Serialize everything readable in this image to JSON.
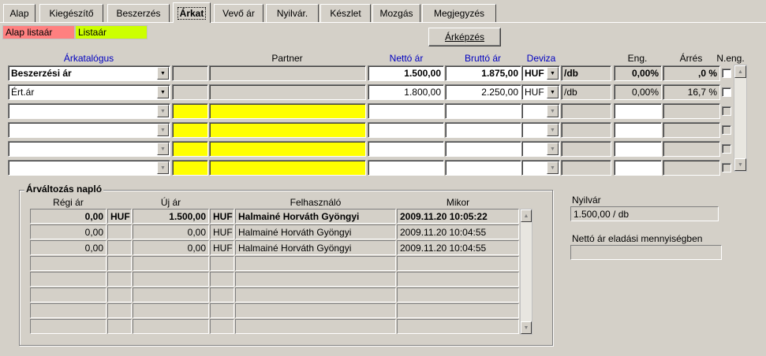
{
  "tabs": [
    "Alap",
    "Kiegészítő",
    "Beszerzés",
    "Árkat",
    "Vevő ár",
    "Nyilvár.",
    "Készlet",
    "Mozgás",
    "Megjegyzés"
  ],
  "legend": {
    "alap_listaar": "Alap listaár",
    "listaar": "Listaár",
    "alap_color": "#ff8080",
    "lista_color": "#ccff00"
  },
  "arkepzes_button": "Árképzés",
  "headers": {
    "arkatalogus": "Árkatalógus",
    "partner": "Partner",
    "netto": "Nettó ár",
    "brutto": "Bruttó ár",
    "deviza": "Deviza",
    "eng": "Eng.",
    "arres": "Árrés",
    "neng": "N.eng."
  },
  "rows": [
    {
      "katalogus": "Beszerzési ár",
      "partner_code": "",
      "partner": "",
      "netto": "1.500,00",
      "brutto": "1.875,00",
      "deviza": "HUF",
      "unit": "/db",
      "eng": "0,00%",
      "arres": ",0 %",
      "bold": true
    },
    {
      "katalogus": "Ért.ár",
      "partner_code": "",
      "partner": "",
      "netto": "1.800,00",
      "brutto": "2.250,00",
      "deviza": "HUF",
      "unit": "/db",
      "eng": "0,00%",
      "arres": "16,7 %",
      "bold": false
    }
  ],
  "log": {
    "title": "Árváltozás napló",
    "headers": {
      "regi": "Régi ár",
      "uj": "Új ár",
      "felhasznalo": "Felhasználó",
      "mikor": "Mikor"
    },
    "rows": [
      {
        "regi": "0,00",
        "regi_cur": "HUF",
        "uj": "1.500,00",
        "uj_cur": "HUF",
        "user": "Halmainé Horváth Gyöngyi",
        "time": "2009.11.20 10:05:22",
        "bold": true
      },
      {
        "regi": "0,00",
        "regi_cur": "",
        "uj": "0,00",
        "uj_cur": "HUF",
        "user": "Halmainé Horváth Gyöngyi",
        "time": "2009.11.20 10:04:55",
        "bold": false
      },
      {
        "regi": "0,00",
        "regi_cur": "",
        "uj": "0,00",
        "uj_cur": "HUF",
        "user": "Halmainé Horváth Gyöngyi",
        "time": "2009.11.20 10:04:55",
        "bold": false
      }
    ]
  },
  "nyilvar": {
    "label": "Nyilvár",
    "value": "1.500,00 / db"
  },
  "netto_eladasi": {
    "label": "Nettó ár eladási mennyiségben",
    "value": ""
  }
}
